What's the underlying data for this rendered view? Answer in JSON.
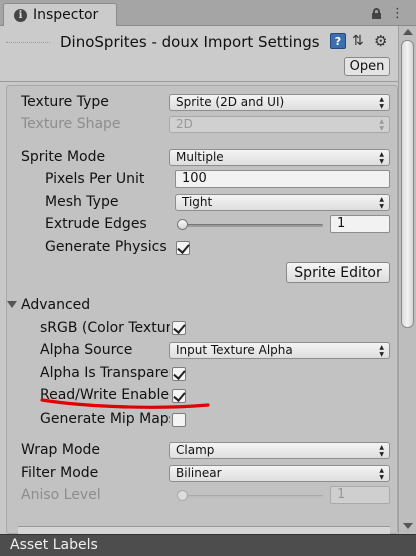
{
  "window": {
    "tab_label": "Inspector"
  },
  "header": {
    "title": "DinoSprites - doux Import Settings",
    "open_label": "Open",
    "icons": [
      "help-icon",
      "sliders-icon",
      "gear-icon"
    ]
  },
  "settings": {
    "texture_type": {
      "label": "Texture Type",
      "value": "Sprite (2D and UI)"
    },
    "texture_shape": {
      "label": "Texture Shape",
      "value": "2D"
    },
    "sprite_mode": {
      "label": "Sprite Mode",
      "value": "Multiple"
    },
    "pixels_per_unit": {
      "label": "Pixels Per Unit",
      "value": "100"
    },
    "mesh_type": {
      "label": "Mesh Type",
      "value": "Tight"
    },
    "extrude_edges": {
      "label": "Extrude Edges",
      "value": "1"
    },
    "generate_physics": {
      "label": "Generate Physics Shape",
      "checked": true
    },
    "sprite_editor_label": "Sprite Editor"
  },
  "advanced": {
    "label": "Advanced",
    "srgb": {
      "label": "sRGB (Color Texture)",
      "checked": true
    },
    "alpha_source": {
      "label": "Alpha Source",
      "value": "Input Texture Alpha"
    },
    "alpha_transparency": {
      "label": "Alpha Is Transparency",
      "checked": true
    },
    "read_write": {
      "label": "Read/Write Enabled",
      "checked": true
    },
    "generate_mip_maps": {
      "label": "Generate Mip Maps",
      "checked": false
    }
  },
  "wrap": {
    "wrap_mode": {
      "label": "Wrap Mode",
      "value": "Clamp"
    },
    "filter_mode": {
      "label": "Filter Mode",
      "value": "Bilinear"
    },
    "aniso_level": {
      "label": "Aniso Level",
      "value": "1"
    }
  },
  "footer": {
    "asset_labels": "Asset Labels"
  },
  "colors": {
    "annotation": "#e00000",
    "asset_bar": "#4d4d4d"
  }
}
